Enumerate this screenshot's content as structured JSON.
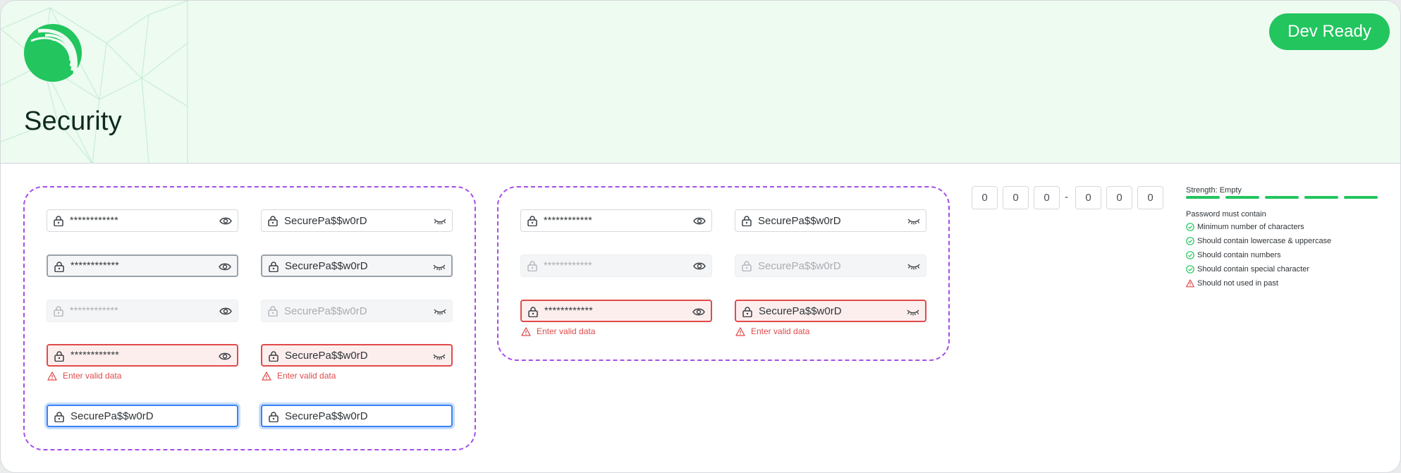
{
  "header": {
    "title": "Security",
    "badge": "Dev Ready"
  },
  "colors": {
    "brand_green": "#22c55e",
    "header_bg": "#edfbf1",
    "group_border": "#a64ee6",
    "error": "#e14a4a",
    "focus": "#3b82f6"
  },
  "group_a": {
    "masked_value": "************",
    "plain_value": "SecurePa$$w0rD",
    "error_text": "Enter valid data"
  },
  "group_b": {
    "masked_value": "************",
    "plain_value": "SecurePa$$w0rD",
    "error_text": "Enter valid data"
  },
  "otp": {
    "digits": [
      "0",
      "0",
      "0",
      "0",
      "0",
      "0"
    ],
    "separator": "-"
  },
  "strength": {
    "label": "Strength: Empty",
    "segments": 5
  },
  "requirements": {
    "title": "Password must contain",
    "items": [
      {
        "text": "Minimum number of characters",
        "status": "ok"
      },
      {
        "text": "Should contain lowercase & uppercase",
        "status": "ok"
      },
      {
        "text": "Should contain numbers",
        "status": "ok"
      },
      {
        "text": "Should contain special character",
        "status": "ok"
      },
      {
        "text": "Should not used in past",
        "status": "warning"
      }
    ]
  },
  "icons": {
    "lock": "lock-icon",
    "show": "eye-icon",
    "hide": "eye-closed-icon",
    "error": "warning-icon",
    "check": "check-circle-icon"
  }
}
